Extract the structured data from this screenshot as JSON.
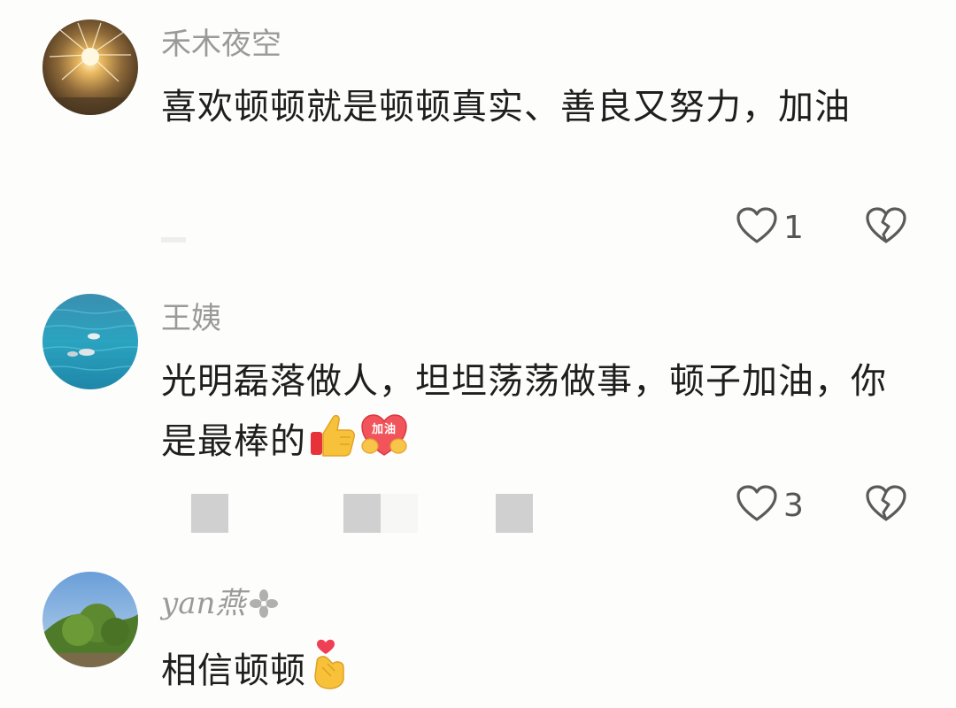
{
  "comments": [
    {
      "username": "禾木夜空",
      "text": "喜欢顿顿就是顿顿真实、善良又努力，加油",
      "emoji": [],
      "likes": "1",
      "avatar": "fireworks-photo-avatar"
    },
    {
      "username": "王姨",
      "text": "光明磊落做人，坦坦荡荡做事，顿子加油，你是最棒的",
      "emoji": [
        "thumbs-up-emoji",
        "jiayou-heart-emoji"
      ],
      "emoji_label": "加油",
      "likes": "3",
      "avatar": "sea-swans-photo-avatar"
    },
    {
      "username": "yan燕",
      "text": "相信顿顿",
      "emoji": [
        "finger-heart-emoji"
      ],
      "avatar": "tree-landscape-photo-avatar"
    }
  ],
  "icons": {
    "like": "heart-outline-icon",
    "dislike": "broken-heart-icon"
  },
  "colors": {
    "username": "#9a9a9a",
    "text": "#1e1e1e",
    "icon": "#555555",
    "background": "#fdfdfc"
  }
}
